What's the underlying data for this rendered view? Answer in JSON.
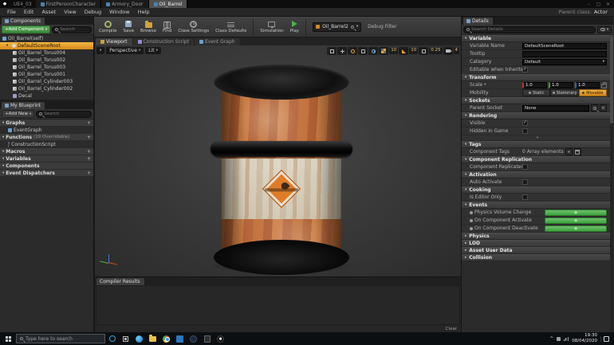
{
  "icons": {
    "dropdown_arrow": "▾",
    "expand_arrow": "▸",
    "check": "✓",
    "close": "✕",
    "plus": "+",
    "minus": "–",
    "maximize": "□",
    "up_caret": "^",
    "fx": "ƒ"
  },
  "colors": {
    "selection_orange": "#e89b2d",
    "button_green": "#4caf50",
    "axis_x": "#b2382a",
    "axis_y": "#4a9a2a",
    "axis_z": "#2a66b2"
  },
  "window": {
    "project_title": "UE4_03",
    "doc_tabs": [
      {
        "label": "FirstPersonCharacter"
      },
      {
        "label": "Armory_Door"
      },
      {
        "label": "Oil_Barrel"
      }
    ],
    "menus": [
      "File",
      "Edit",
      "Asset",
      "View",
      "Debug",
      "Window",
      "Help"
    ],
    "parent_class_label": "Parent class:",
    "parent_class_value": "Actor"
  },
  "toolbar": {
    "compile": "Compile",
    "save": "Save",
    "browse": "Browse",
    "find": "Find",
    "class_settings": "Class Settings",
    "class_defaults": "Class Defaults",
    "simulation": "Simulation",
    "play": "Play",
    "debug_object": "Oil_Barrel2",
    "debug_filter_label": "Debug Filter"
  },
  "components_panel": {
    "tab": "Components",
    "add_component": "+Add Component",
    "search_placeholder": "Search",
    "items": [
      {
        "label": "Oil_Barrel(self)"
      },
      {
        "label": "DefaultSceneRoot"
      },
      {
        "label": "Oil_Barrel_Torus004"
      },
      {
        "label": "Oil_Barrel_Torus002"
      },
      {
        "label": "Oil_Barrel_Torus003"
      },
      {
        "label": "Oil_Barrel_Torus001"
      },
      {
        "label": "Oil_Barrel_Cylinder003"
      },
      {
        "label": "Oil_Barrel_Cylinder002"
      },
      {
        "label": "Decal"
      }
    ]
  },
  "my_blueprint": {
    "tab": "My Blueprint",
    "add_new": "+Add New",
    "search_placeholder": "Search",
    "graphs_header": "Graphs",
    "eventgraph_item": "EventGraph",
    "functions_header": "Functions",
    "functions_note": "(19 Overridable)",
    "construction_item": "ConstructionScript",
    "macros_header": "Macros",
    "variables_header": "Variables",
    "components_header": "Components",
    "dispatchers_header": "Event Dispatchers"
  },
  "viewport": {
    "tabs": [
      {
        "label": "Viewport"
      },
      {
        "label": "Construction Script"
      },
      {
        "label": "Event Graph"
      }
    ],
    "perspective_label": "Perspective",
    "shading_label": "Lit",
    "grid_snap_value": "10",
    "rotation_snap_value": "10",
    "scale_snap_value": "0.25",
    "camera_speed_value": "4",
    "compiler": {
      "tab": "Compiler Results",
      "clear_label": "Clear"
    }
  },
  "details": {
    "tab": "Details",
    "search_placeholder": "Search Details",
    "variable": {
      "title": "Variable",
      "name_label": "Variable Name",
      "name_value": "DefaultSceneRoot",
      "tooltip_label": "Tooltip",
      "tooltip_value": "",
      "category_label": "Category",
      "category_value": "Default",
      "editable_label": "Editable when Inherited"
    },
    "transform": {
      "title": "Transform",
      "scale_label": "Scale",
      "scale_x": "1.0",
      "scale_y": "1.0",
      "scale_z": "1.0",
      "mobility_label": "Mobility",
      "mobility_static": "Static",
      "mobility_stationary": "Stationary",
      "mobility_movable": "Movable"
    },
    "sockets": {
      "title": "Sockets",
      "parent_socket_label": "Parent Socket",
      "parent_socket_value": "None"
    },
    "rendering": {
      "title": "Rendering",
      "visible_label": "Visible",
      "hidden_label": "Hidden in Game"
    },
    "tags": {
      "title": "Tags",
      "component_tags_label": "Component Tags",
      "component_tags_value": "0 Array elements"
    },
    "replication": {
      "title": "Component Replication",
      "replicates_label": "Component Replicates"
    },
    "activation": {
      "title": "Activation",
      "auto_activate_label": "Auto Activate"
    },
    "cooking": {
      "title": "Cooking",
      "editor_only_label": "Is Editor Only"
    },
    "events": {
      "title": "Events",
      "items": [
        {
          "label": "Physics Volume Change"
        },
        {
          "label": "On Component Activate"
        },
        {
          "label": "On Component Deactivate"
        }
      ]
    },
    "collapsed": [
      {
        "title": "Physics"
      },
      {
        "title": "LOD"
      },
      {
        "title": "Asset User Data"
      },
      {
        "title": "Collision"
      }
    ]
  },
  "taskbar": {
    "search_placeholder": "Type here to search",
    "time": "19:30",
    "date": "08/04/2020"
  }
}
